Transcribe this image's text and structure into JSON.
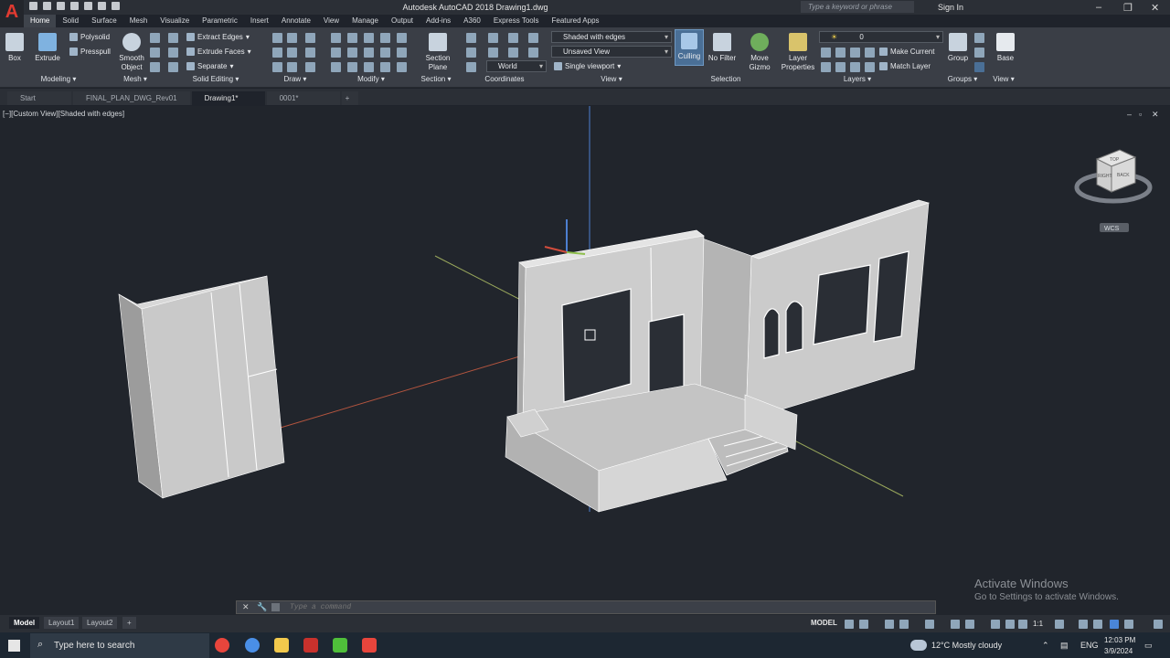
{
  "app": {
    "logo": "A",
    "title": "Autodesk AutoCAD 2018    Drawing1.dwg",
    "search_placeholder": "Type a keyword or phrase",
    "sign_in": "Sign In"
  },
  "ribbon_tabs": [
    "Home",
    "Solid",
    "Surface",
    "Mesh",
    "Visualize",
    "Parametric",
    "Insert",
    "Annotate",
    "View",
    "Manage",
    "Output",
    "Add-ins",
    "A360",
    "Express Tools",
    "Featured Apps"
  ],
  "ribbon": {
    "box": "Box",
    "extrude": "Extrude",
    "polysolid": "Polysolid",
    "presspull": "Presspull",
    "smooth_object": "Smooth Object",
    "extract_edges": "Extract Edges",
    "extrude_faces": "Extrude Faces",
    "separate": "Separate",
    "section_plane": "Section Plane",
    "world": "World",
    "visual_style": "Shaded with edges",
    "named_view": "Unsaved View",
    "viewport": "Single viewport",
    "culling": "Culling",
    "no_filter": "No Filter",
    "move_gizmo": "Move Gizmo",
    "layer_properties": "Layer Properties",
    "layer_value": "0",
    "make_current": "Make Current",
    "match_layer": "Match Layer",
    "group": "Group",
    "base": "Base"
  },
  "panels": [
    "Modeling",
    "Mesh",
    "Solid Editing",
    "Draw",
    "Modify",
    "Section",
    "Coordinates",
    "View",
    "Selection",
    "Layers",
    "Groups",
    "View"
  ],
  "file_tabs": [
    "Start",
    "FINAL_PLAN_DWG_Rev01",
    "Drawing1*",
    "0001*"
  ],
  "viewport": {
    "label": "[−][Custom View][Shaded with edges]",
    "cube_top": "TOP",
    "cube_right": "RIGHT",
    "cube_back": "BACK",
    "wcs": "WCS"
  },
  "watermark": {
    "line1": "Activate Windows",
    "line2": "Go to Settings to activate Windows."
  },
  "command": {
    "placeholder": "Type a command"
  },
  "layout_tabs": [
    "Model",
    "Layout1",
    "Layout2"
  ],
  "status": {
    "model": "MODEL",
    "scale": "1:1"
  },
  "taskbar": {
    "search": "Type here to search",
    "weather": "12°C  Mostly cloudy",
    "lang": "ENG",
    "time": "12:03 PM",
    "date": "3/9/2024"
  }
}
